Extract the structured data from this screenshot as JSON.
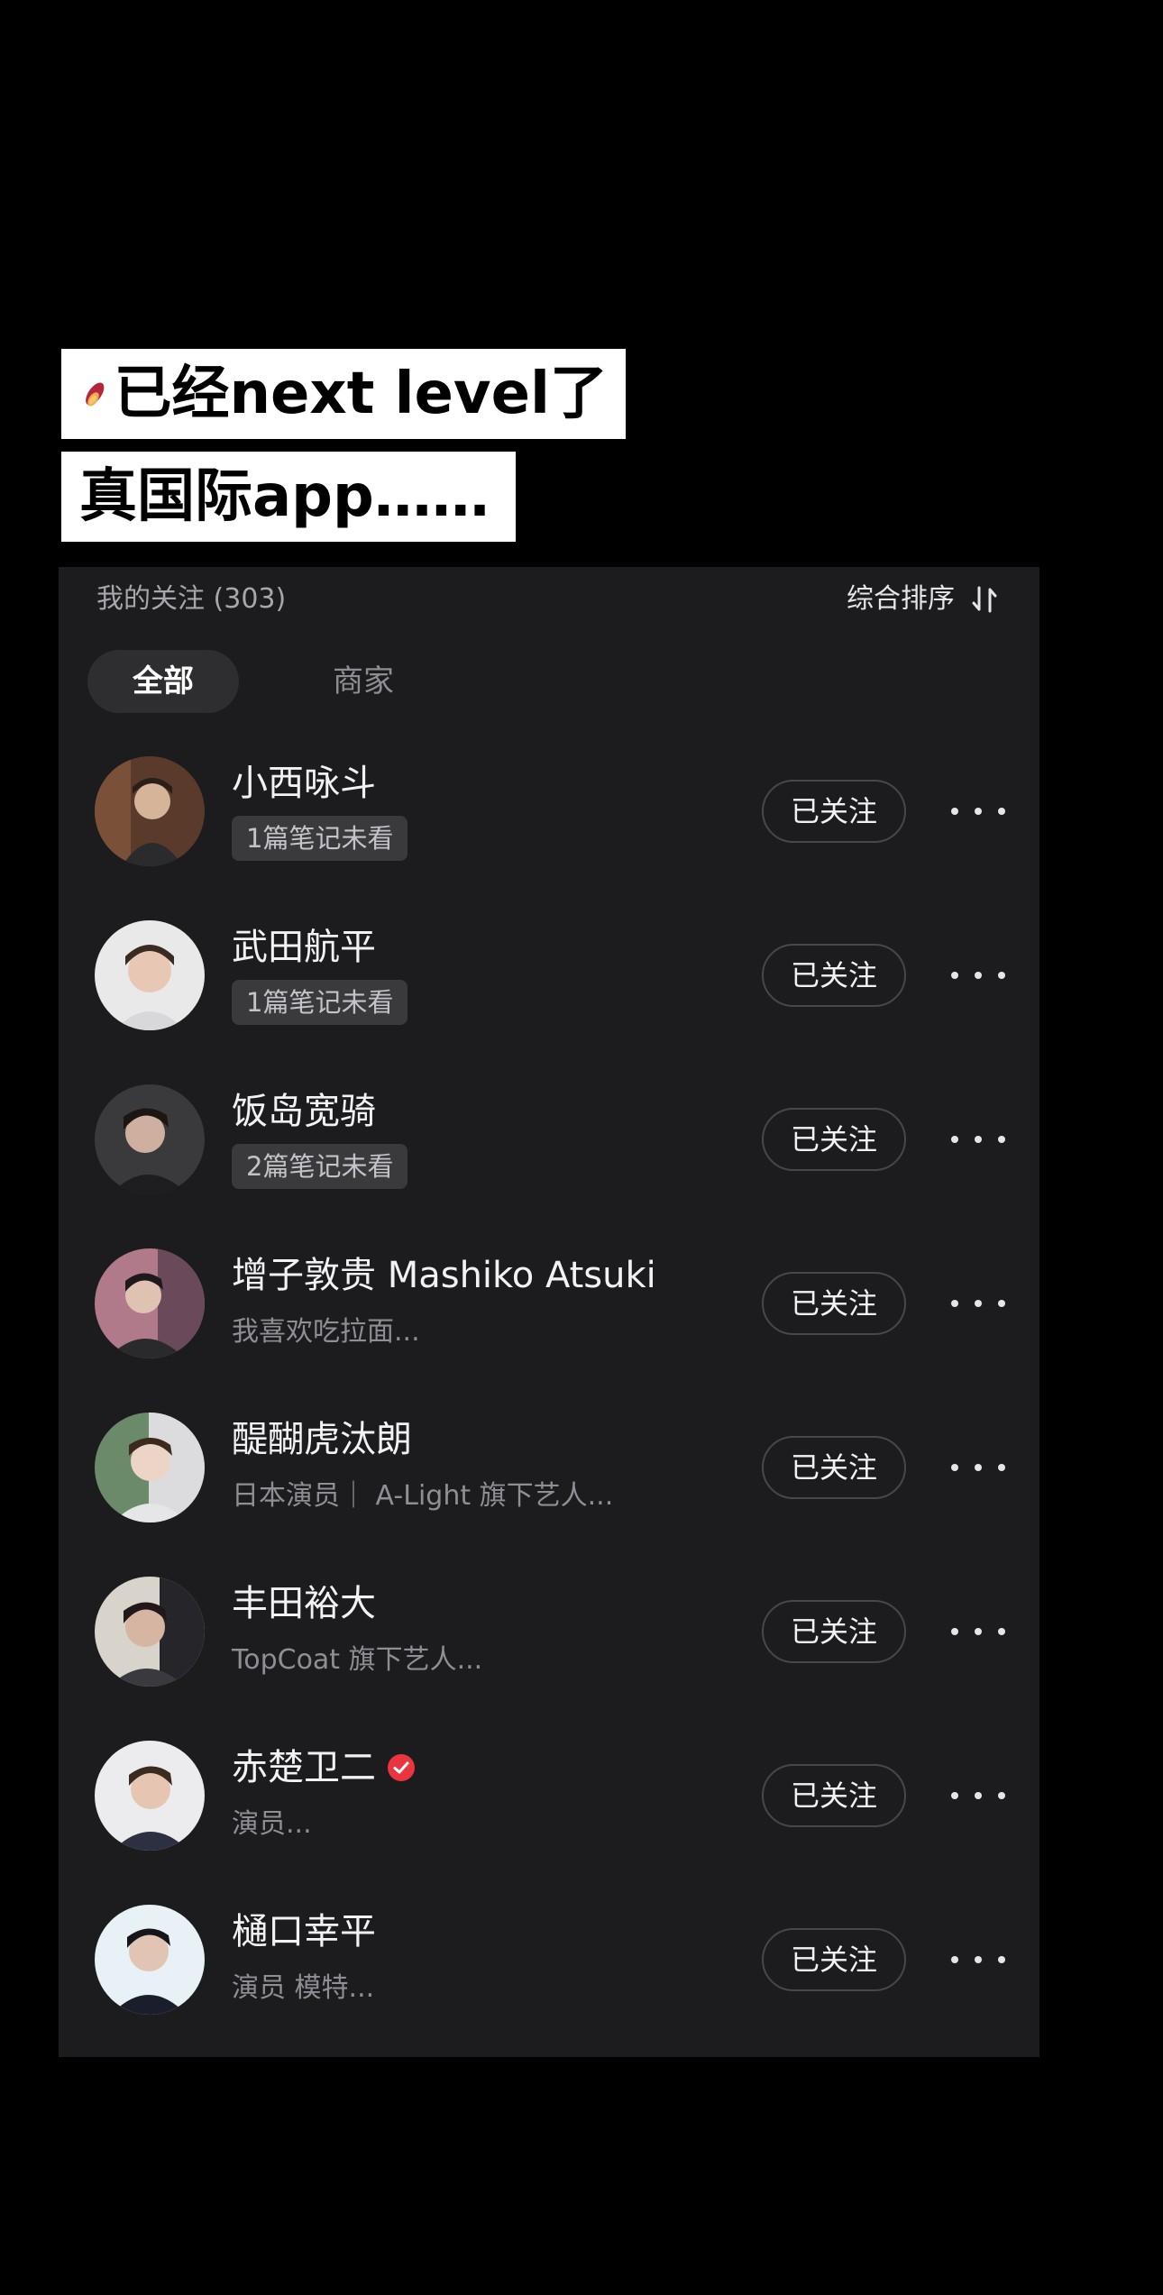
{
  "caption": {
    "line1": "已经next level了",
    "line2": "真国际app……"
  },
  "header": {
    "following_label": "我的关注 (303)",
    "sort_label": "综合排序"
  },
  "tabs": [
    {
      "label": "全部",
      "active": true
    },
    {
      "label": "商家",
      "active": false
    }
  ],
  "follow_button_label": "已关注",
  "users": [
    {
      "name": "小西咏斗",
      "chip": "1篇笔记未看",
      "bio": ""
    },
    {
      "name": "武田航平",
      "chip": "1篇笔记未看",
      "bio": ""
    },
    {
      "name": "饭岛宽骑",
      "chip": "2篇笔记未看",
      "bio": ""
    },
    {
      "name": "增子敦贵 Mashiko Atsuki",
      "chip": "",
      "bio": "我喜欢吃拉面..."
    },
    {
      "name": "醍醐虎汰朗",
      "chip": "",
      "bio": "日本演员｜ A-Light 旗下艺人..."
    },
    {
      "name": "丰田裕大",
      "chip": "",
      "bio": "TopCoat 旗下艺人..."
    },
    {
      "name": "赤楚卫二",
      "chip": "",
      "bio": "演员...",
      "verified": true
    },
    {
      "name": "樋口幸平",
      "chip": "",
      "bio": "演员 模特..."
    }
  ],
  "colors": {
    "panel_bg": "#1c1c1e",
    "page_bg": "#000000",
    "verified_badge": "#e8353f"
  },
  "icons": {
    "sort": "sort-arrows-icon",
    "more": "more-dots-icon",
    "verified": "verified-check-icon",
    "caption_emoji": "sweet-potato-icon"
  }
}
